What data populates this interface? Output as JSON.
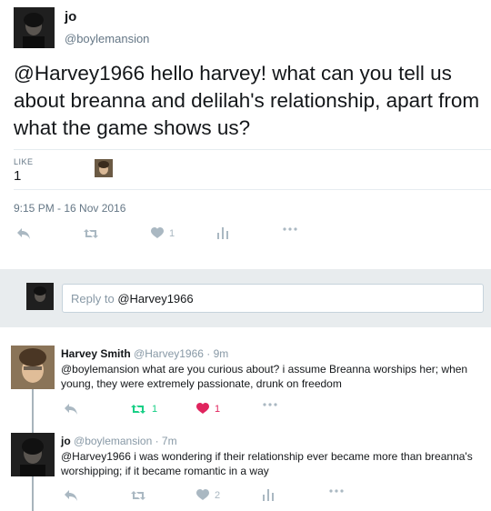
{
  "tweet": {
    "name": "jo",
    "handle": "@boylemansion",
    "text": "@Harvey1966 hello harvey! what can you tell us about breanna and delilah's relationship, apart from what the game shows us?",
    "likes_label": "LIKE",
    "likes_count": "1",
    "timestamp": "9:15 PM - 16 Nov 2016",
    "actions": {
      "like_count": "1"
    }
  },
  "reply_box": {
    "prompt": "Reply to",
    "mention": "@Harvey1966"
  },
  "replies": [
    {
      "name": "Harvey Smith",
      "handle": "@Harvey1966",
      "time": "· 9m",
      "text": "@boylemansion what are you curious about? i assume Breanna worships her; when young, they were extremely passionate, drunk on freedom",
      "retweet_count": "1",
      "like_count": "1"
    },
    {
      "name": "jo",
      "handle": "@boylemansion",
      "time": "· 7m",
      "text": "@Harvey1966 i was wondering if their relationship ever became more than breanna's worshipping; if it became romantic in a way",
      "retweet_count": "",
      "like_count": "2"
    }
  ],
  "colors": {
    "text": "#14171a",
    "muted": "#657786",
    "icon": "#aab8c2",
    "retweet_active": "#19cf86",
    "like_active": "#e0245e",
    "reply_bar_bg": "#e8ecee"
  }
}
